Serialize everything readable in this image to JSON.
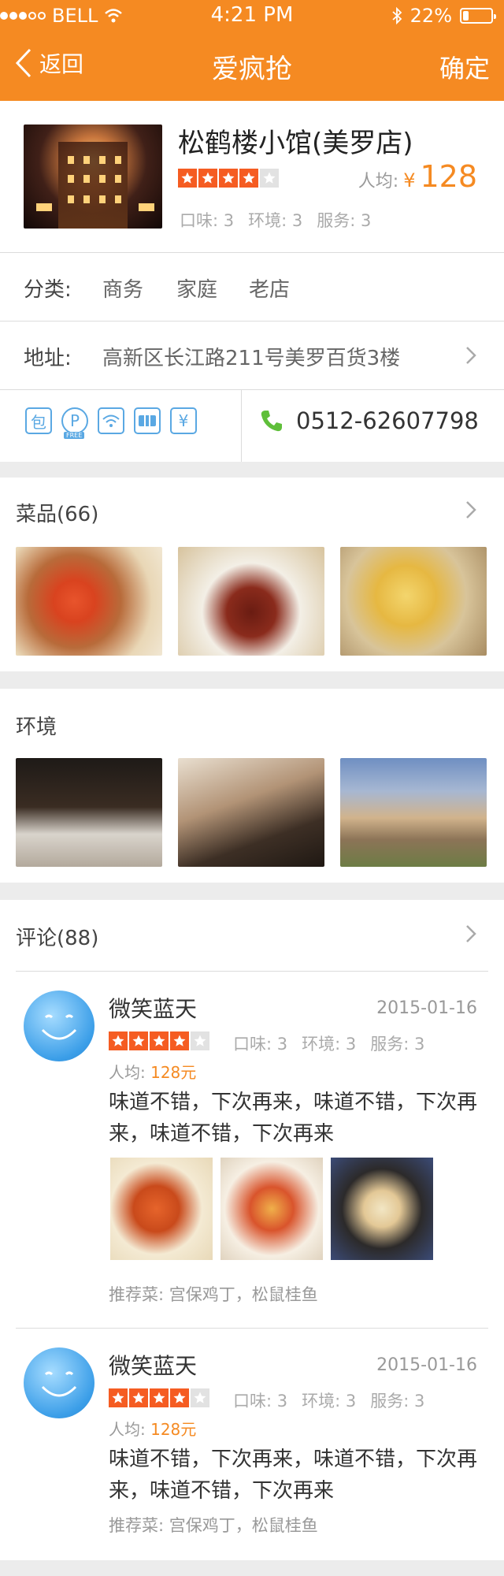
{
  "status": {
    "carrier": "BELL",
    "time": "4:21 PM",
    "battery": "22%",
    "battery_level": 0.22
  },
  "nav": {
    "back": "返回",
    "title": "爱疯抢",
    "confirm": "确定"
  },
  "shop": {
    "name": "松鹤楼小馆(美罗店)",
    "rating": 4,
    "avg_label": "人均:",
    "avg_currency": "¥",
    "avg_price": "128",
    "scores": [
      "口味: 3",
      "环境: 3",
      "服务: 3"
    ]
  },
  "category": {
    "label": "分类:",
    "tags": [
      "商务",
      "家庭",
      "老店"
    ]
  },
  "address": {
    "label": "地址:",
    "value": "高新区长江路211号美罗百货3楼"
  },
  "facilities": {
    "icons": [
      "包",
      "P",
      "wifi",
      "card",
      "¥"
    ],
    "free_label": "FREE",
    "phone": "0512-62607798"
  },
  "dishes": {
    "title": "菜品(66)"
  },
  "environment": {
    "title": "环境"
  },
  "reviews": {
    "title": "评论(88)",
    "items": [
      {
        "user": "微笑蓝天",
        "date": "2015-01-16",
        "rating": 4,
        "scores": [
          "口味: 3",
          "环境: 3",
          "服务: 3"
        ],
        "price_label": "人均:",
        "price": "128元",
        "text": "味道不错，下次再来，味道不错，下次再来，味道不错，下次再来",
        "recommend": "推荐菜: 宫保鸡丁，松鼠桂鱼"
      },
      {
        "user": "微笑蓝天",
        "date": "2015-01-16",
        "rating": 4,
        "scores": [
          "口味: 3",
          "环境: 3",
          "服务: 3"
        ],
        "price_label": "人均:",
        "price": "128元",
        "text": "味道不错，下次再来，味道不错，下次再来，味道不错，下次再来",
        "recommend": "推荐菜: 宫保鸡丁，松鼠桂鱼"
      }
    ]
  },
  "colors": {
    "accent": "#f58a22",
    "star": "#f55c22",
    "icon_blue": "#5aa8e3",
    "phone_green": "#5fbf3a"
  }
}
